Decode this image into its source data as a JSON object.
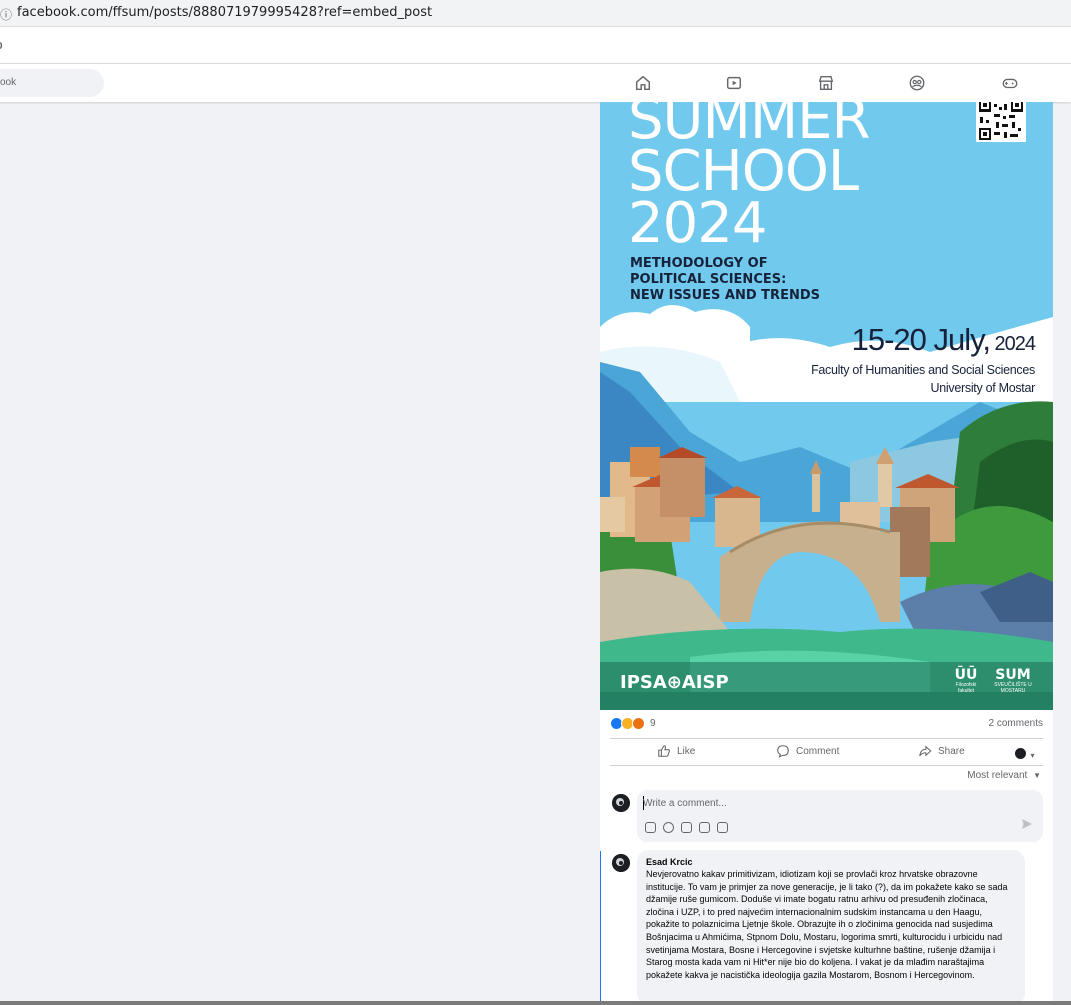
{
  "browser": {
    "url": "facebook.com/ffsum/posts/888071979995428?ref=embed_post",
    "partial_text": "ɔ"
  },
  "fbnav": {
    "search_partial": "ook",
    "icons": [
      "home-icon",
      "video-icon",
      "marketplace-icon",
      "groups-icon",
      "gaming-icon"
    ]
  },
  "poster": {
    "title_line1": "SUMMER",
    "title_line2": "SCHOOL",
    "title_line3": "2024",
    "subtitle_line1": "METHODOLOGY OF",
    "subtitle_line2": "POLITICAL SCIENCES:",
    "subtitle_line3": "NEW ISSUES AND TRENDS",
    "date_main": "15-20 July,",
    "date_year": " 2024",
    "faculty": "Faculty of Humanities and Social Sciences",
    "university": "University of Mostar",
    "ipsa": "IPSA⊕AISP",
    "logo1_text": "Filozofski fakultet",
    "logo2_text": "SVEUČILIŠTE U MOSTARU"
  },
  "reactions": {
    "count": "9",
    "comments": "2 comments",
    "colors": {
      "like": "#1877f2",
      "haha": "#f7b125",
      "angry": "#e9710f"
    }
  },
  "actions": {
    "like": "Like",
    "comment": "Comment",
    "share": "Share"
  },
  "sort": {
    "label": "Most relevant"
  },
  "composer": {
    "placeholder": "Write a comment..."
  },
  "comment": {
    "author": "Esad Krcic",
    "text": "Nevjerovatno kakav primitivizam, idiotizam koji se provlači kroz hrvatske obrazovne institucije. To vam je primjer za nove generacije, je li tako (?), da im pokažete kako se sada džamije ruše gumicom. Doduše vi imate bogatu ratnu arhivu od presuđenih zločinaca, zločina i UZP, i to pred najvećim internacionalnim sudskim instancama u den Haagu, pokažite to polaznicima Ljetnje škole. Obrazujte ih o zločinima genocida nad susjedima Bošnjacima u Ahmićima, Stpnom Dolu, Mostaru, logorima smrti, kulturocidu i urbicidu nad svetinjama Mostara, Bosne i Hercegovine i svjetske kulturhne baštine, rušenje džamija i Starog mosta kada vam ni Hit*er nije bio do koljena. I vakat je da mlađim naraštajima pokažete kakva je nacistička ideologija gazila Mostarom, Bosnom i Hercegovinom."
  }
}
